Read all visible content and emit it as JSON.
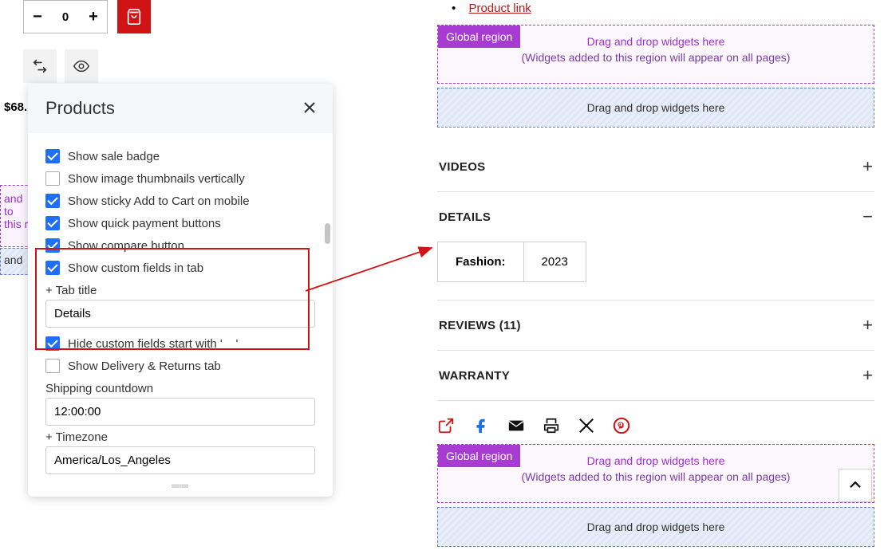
{
  "product": {
    "qty": "0",
    "price": "$68."
  },
  "left_dashed": {
    "line1": "and",
    "line2": "to this r"
  },
  "left_drop": "and",
  "panel": {
    "title": "Products",
    "items": {
      "sale_badge": "Show sale badge",
      "thumbnails": "Show image thumbnails vertically",
      "sticky_cart": "Show sticky Add to Cart on mobile",
      "quick_payment": "Show quick payment buttons",
      "compare": "Show compare button",
      "custom_fields": "Show custom fields in tab",
      "tab_title_label": "+ Tab title",
      "tab_title_value": "Details",
      "hide_custom": "Hide custom fields start with '__'",
      "delivery_returns": "Show Delivery & Returns tab",
      "shipping_label": "Shipping countdown",
      "shipping_value": "12:00:00",
      "timezone_label": "+ Timezone",
      "timezone_value": "America/Los_Angeles"
    }
  },
  "right": {
    "product_link": "Product link",
    "global_tag": "Global region",
    "drag_text": "Drag and drop widgets here",
    "global_sub": "(Widgets added to this region will appear on all pages)",
    "videos": "VIDEOS",
    "details": "DETAILS",
    "detail_key": "Fashion:",
    "detail_val": "2023",
    "reviews": "REVIEWS (11)",
    "warranty": "WARRANTY"
  }
}
